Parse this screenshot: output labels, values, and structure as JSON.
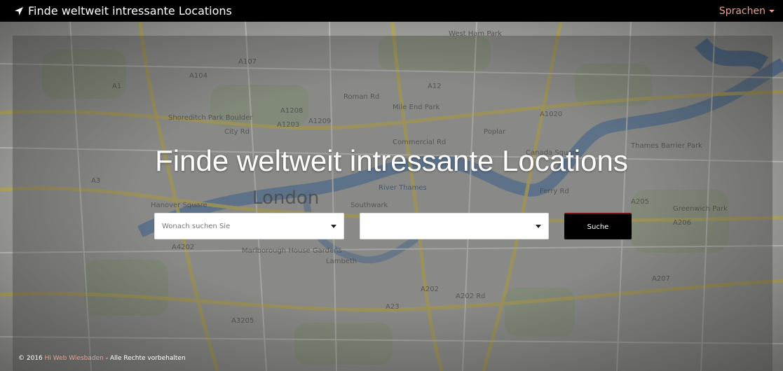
{
  "navbar": {
    "brand_title": "Finde weltweit intressante Locations",
    "brand_icon": "location-arrow-icon",
    "language_label": "Sprachen"
  },
  "hero": {
    "title": "Finde weltweit intressante Locations"
  },
  "search": {
    "what_placeholder": "Wonach suchen Sie",
    "where_value": "",
    "button_label": "Suche"
  },
  "footer": {
    "copyright": "© 2016",
    "company_link": "Hi Web Wiesbaden",
    "rights": "- Alle Rechte vorbehalten"
  },
  "colors": {
    "navbar_bg": "#000000",
    "accent": "#e8a08c",
    "button_bg": "#000000"
  },
  "map_labels": [
    "A104",
    "A107",
    "A1",
    "Shoreditch Park Boulder",
    "A1208",
    "A1209",
    "Roman Rd",
    "Mile End Park",
    "A12",
    "A1020",
    "City Rd",
    "Commercial Rd",
    "Poplar",
    "Canada Square",
    "River Thames",
    "London",
    "Hanover Square",
    "Southwark",
    "Marlborough House Gardens",
    "Lambeth",
    "A4202",
    "A202",
    "A202 Rd",
    "A23",
    "A3205",
    "A205",
    "A206",
    "A207",
    "Greenwich Park",
    "West Ham Park",
    "Thames Barrier Park",
    "Ferry Rd",
    "A1203",
    "A3"
  ]
}
